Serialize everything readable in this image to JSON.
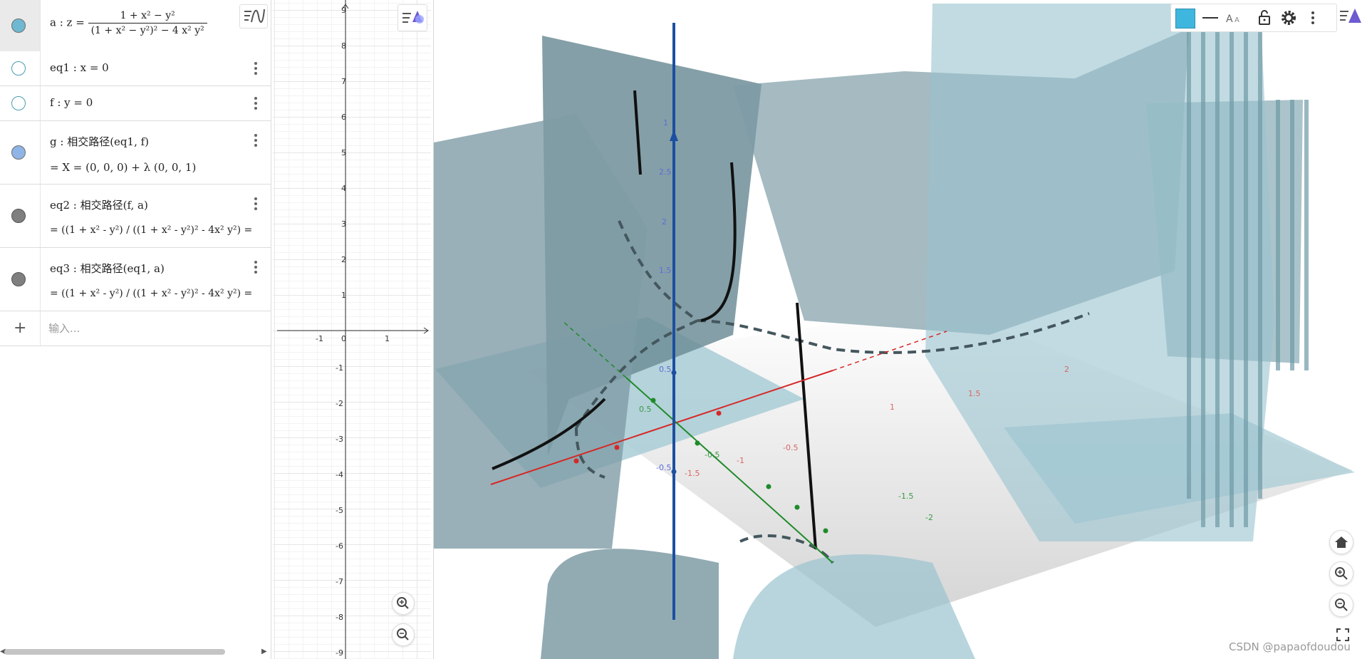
{
  "algebra": {
    "rows": [
      {
        "id": "a",
        "label": "a : z =",
        "num": "1 + x² − y²",
        "den": "(1 + x² − y²)² − 4 x² y²",
        "marble_color": "#6fb8d2",
        "visible": true
      },
      {
        "id": "eq1",
        "text": "eq1 : x = 0",
        "marble_color": "#5aa4b8",
        "visible": false
      },
      {
        "id": "f",
        "text": "f : y = 0",
        "marble_color": "#5aa4b8",
        "visible": false
      },
      {
        "id": "g",
        "text": "g : 相交路径(eq1, f)",
        "text2": "= X = (0, 0, 0) + λ (0, 0, 1)",
        "marble_color": "#8fb4e6",
        "visible": true
      },
      {
        "id": "eq2",
        "text": "eq2 : 相交路径(f, a)",
        "text2": "= ((1 + x² - y²) / ((1 + x² - y²)² - 4x² y²) =",
        "marble_color": "#7f7f7f",
        "visible": true
      },
      {
        "id": "eq3",
        "text": "eq3 : 相交路径(eq1, a)",
        "text2": "= ((1 + x² - y²) / ((1 + x² - y²)² - 4x² y²) =",
        "marble_color": "#7f7f7f",
        "visible": true
      }
    ],
    "input_placeholder": "输入..."
  },
  "graphics2d": {
    "y_ticks": [
      "9",
      "8",
      "7",
      "6",
      "5",
      "4",
      "3",
      "2",
      "1",
      "-1",
      "-2",
      "-3",
      "-4",
      "-5",
      "-6",
      "-7",
      "-8",
      "-9"
    ],
    "x_ticks": [
      "-1",
      "0",
      "1"
    ]
  },
  "graphics3d": {
    "axis_labels": {
      "z": [
        "1",
        "2.5",
        "2",
        "1.5",
        "0.5",
        "-0.5"
      ],
      "x": [
        "-0.5",
        "-1",
        "-1.5",
        "1",
        "1.5",
        "2"
      ],
      "y": [
        "0.5",
        "-0.5",
        "-1.5",
        "-2"
      ]
    }
  },
  "watermark": "CSDN @papaofdoudou",
  "colors": {
    "surface": "#9ac3cf",
    "surface_dark": "#6f8e98",
    "z_axis": "#1c4fa0",
    "x_axis": "#d62828",
    "y_axis": "#1f8a2a",
    "accent": "#3fb6dd"
  }
}
